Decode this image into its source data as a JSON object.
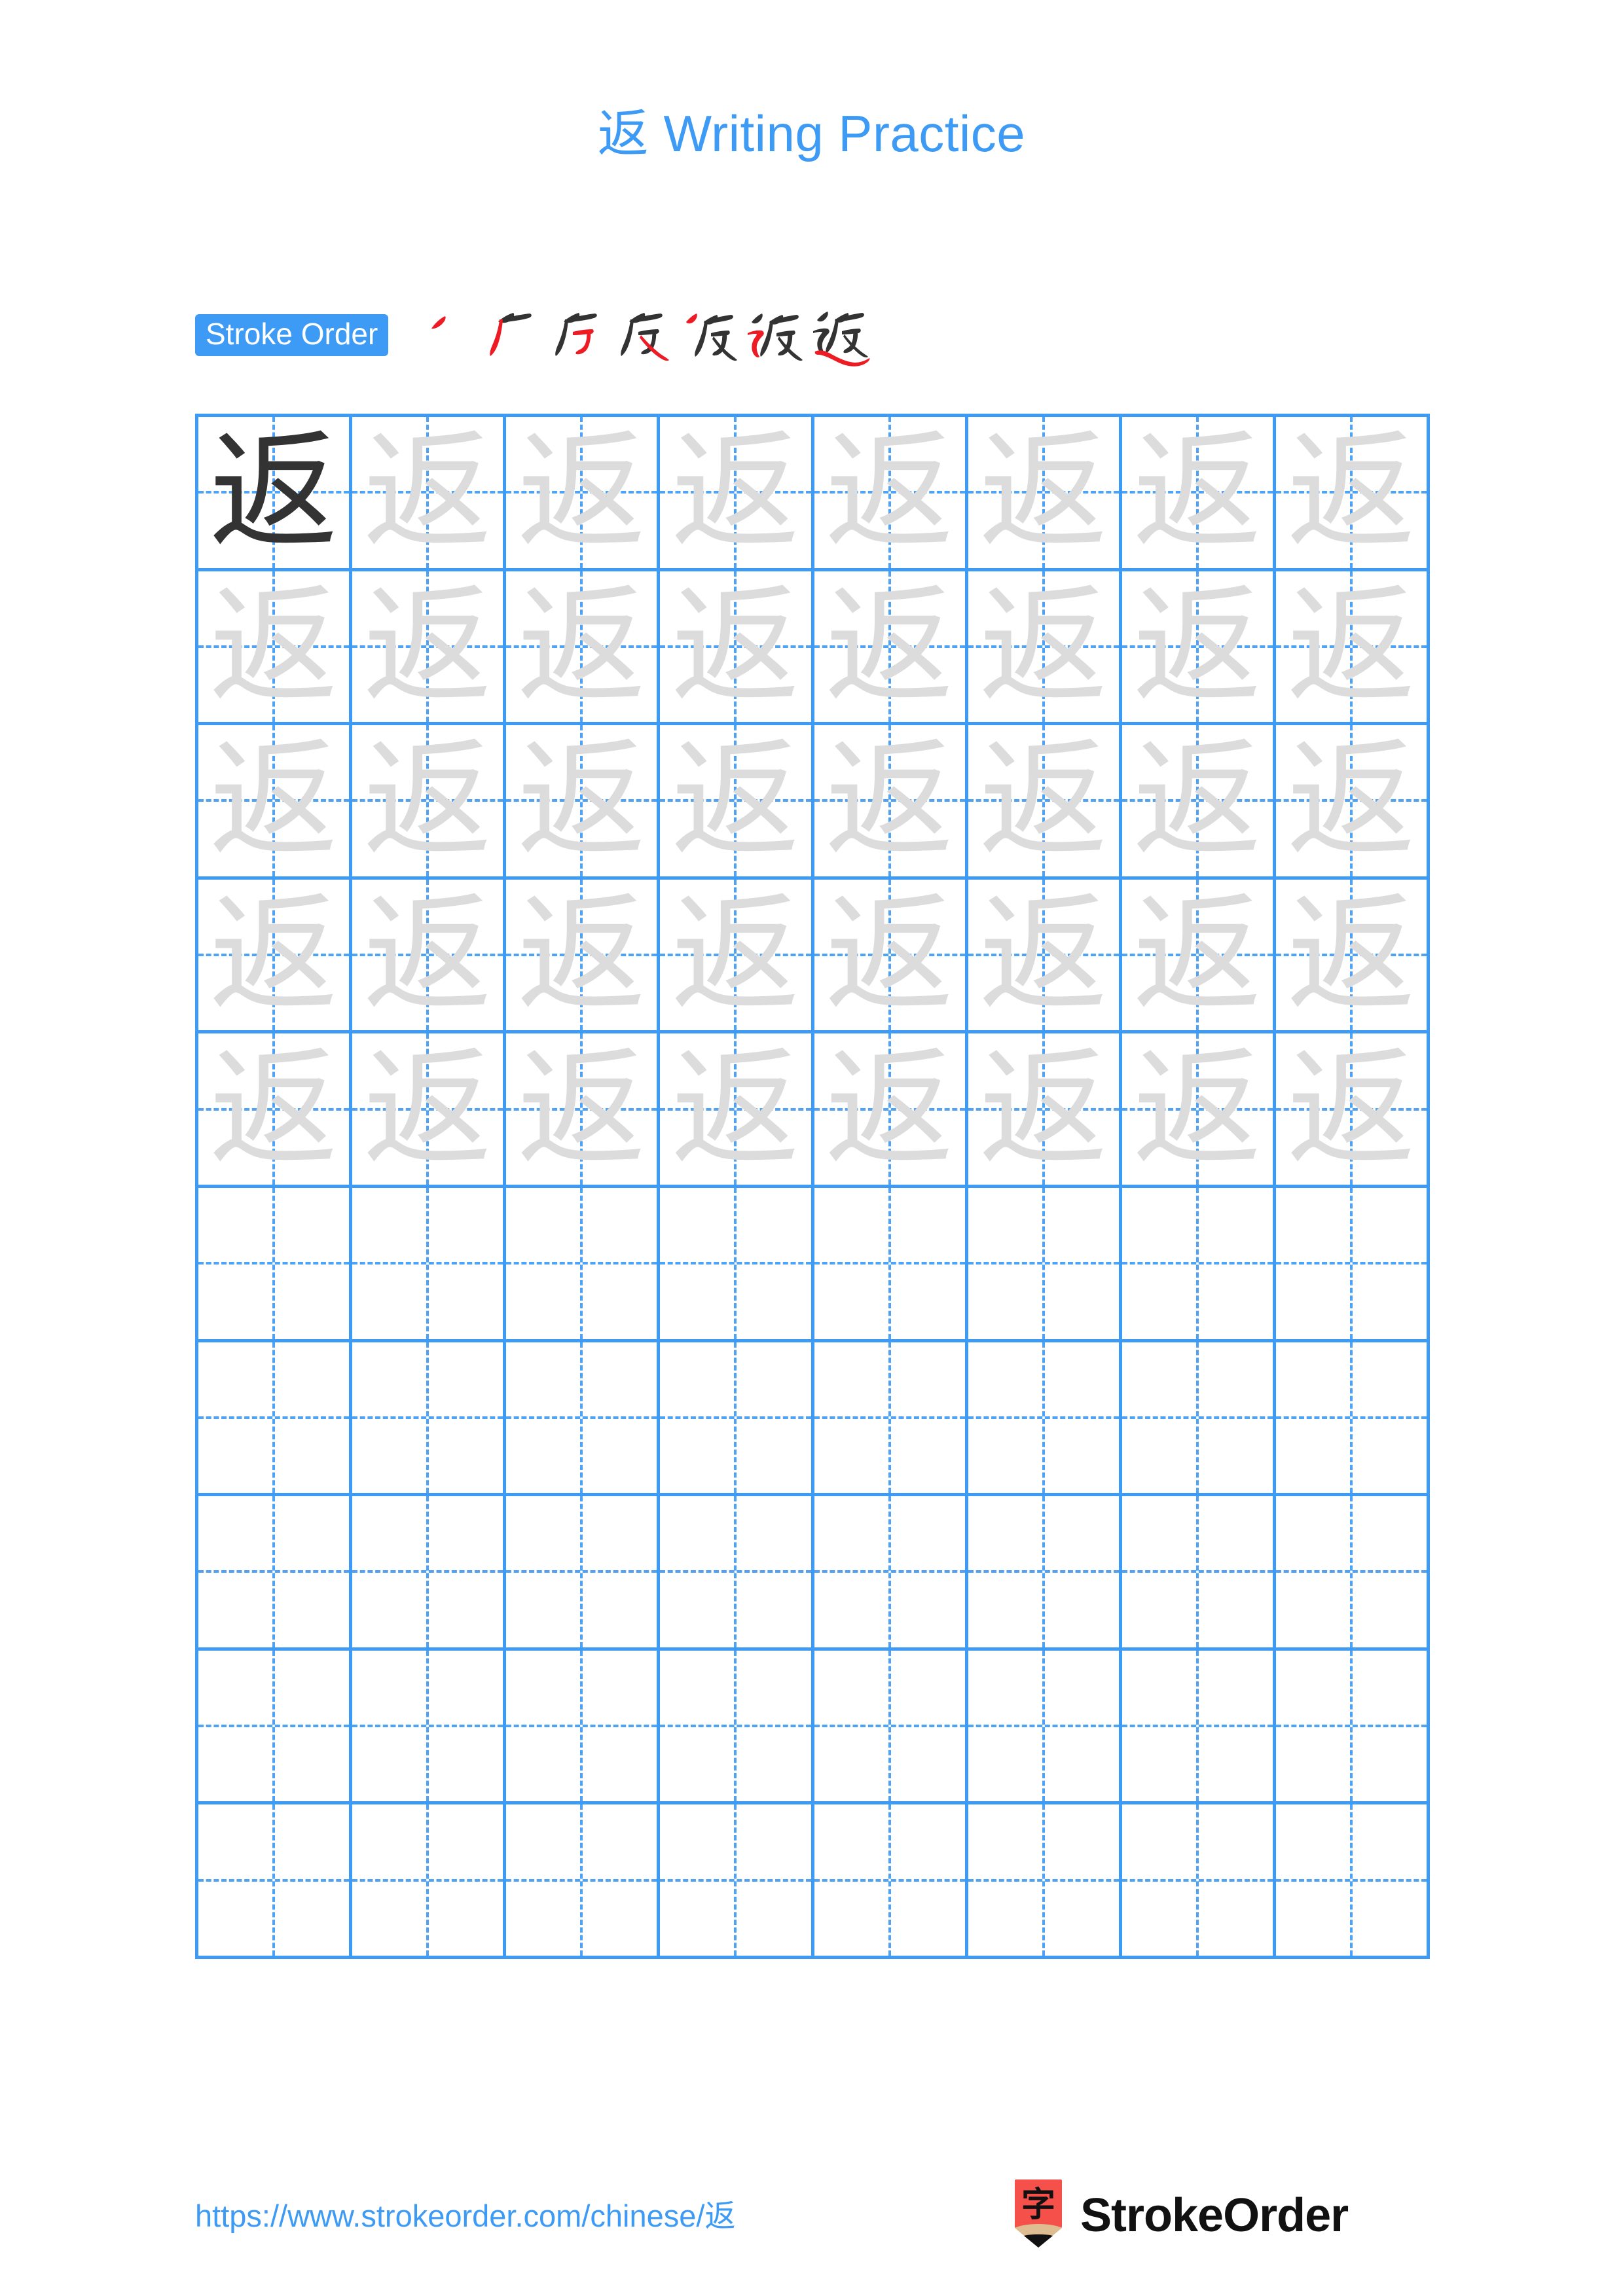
{
  "page": {
    "title": "返 Writing Practice",
    "character": "返",
    "background_color": "#ffffff",
    "accent_color": "#3D9BF5",
    "trace_color": "#DCDCDC",
    "model_color": "#333333",
    "highlight_stroke_color": "#ED1C24"
  },
  "stroke_order": {
    "badge_label": "Stroke Order",
    "steps": [
      {
        "index": 1,
        "partial": "丶"
      },
      {
        "index": 2,
        "partial": "厂"
      },
      {
        "index": 3,
        "partial": "厃"
      },
      {
        "index": 4,
        "partial": "反"
      },
      {
        "index": 5,
        "partial": "反丶"
      },
      {
        "index": 6,
        "partial": "反乛"
      },
      {
        "index": 7,
        "partial": "返"
      }
    ],
    "total_strokes": 7
  },
  "practice_grid": {
    "columns": 8,
    "rows": 10,
    "filled_rows": 5,
    "empty_rows": 5,
    "model_cell": {
      "row": 1,
      "column": 1
    },
    "cell_character": "返",
    "guide_style": "dashed-crosshair",
    "border_color": "#3D9BF5",
    "guide_color": "#4FA3F7"
  },
  "footer": {
    "url": "https://www.strokeorder.com/chinese/返",
    "brand_name": "StrokeOrder",
    "logo_character": "字",
    "logo_body_color": "#F5504A",
    "logo_tip_color": "#DFBD92",
    "logo_point_color": "#111111"
  }
}
